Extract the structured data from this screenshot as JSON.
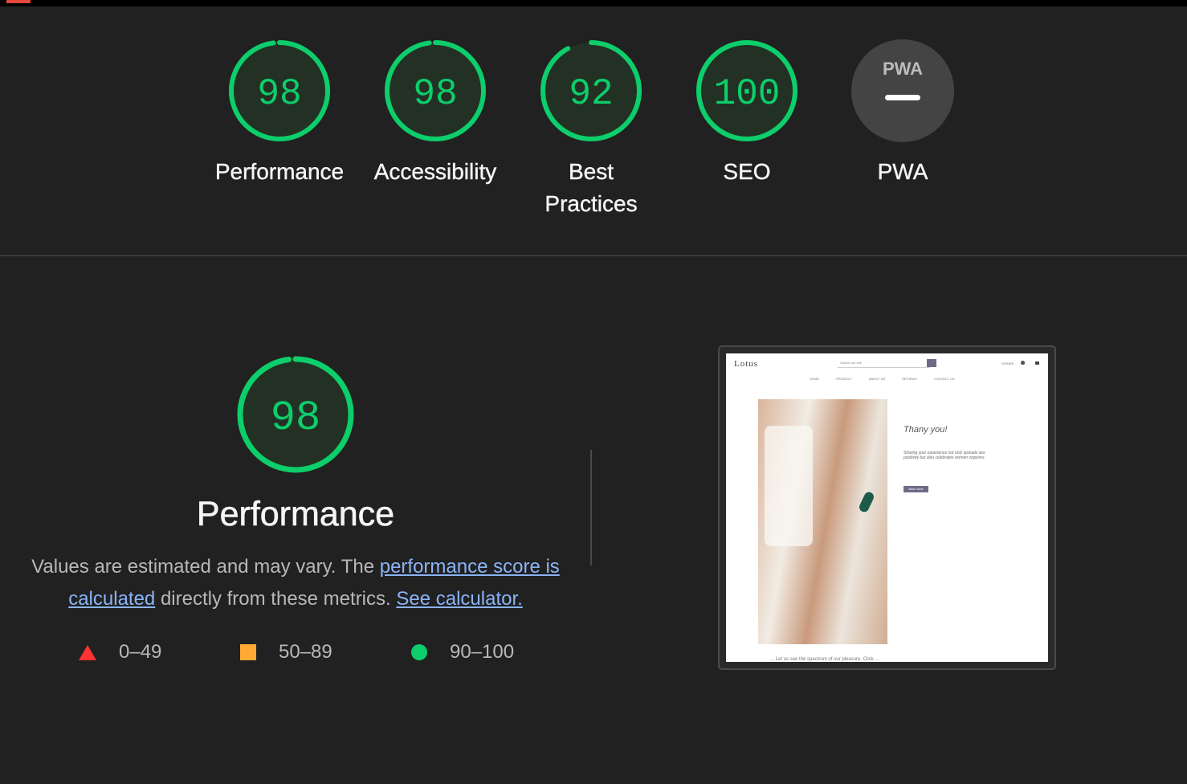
{
  "summary": {
    "gauges": [
      {
        "score": "98",
        "label_lines": [
          "Performance"
        ]
      },
      {
        "score": "98",
        "label_lines": [
          "Accessibility"
        ]
      },
      {
        "score": "92",
        "label_lines": [
          "Best",
          "Practices"
        ]
      },
      {
        "score": "100",
        "label_lines": [
          "SEO"
        ]
      }
    ],
    "pwa": {
      "badge": "PWA",
      "label": "PWA"
    }
  },
  "performance": {
    "score": "98",
    "title": "Performance",
    "desc_prefix": "Values are estimated and may vary. The ",
    "link_score": "performance score is calculated",
    "desc_middle": " directly from these metrics. ",
    "link_calculator": "See calculator.",
    "legend": [
      {
        "range": "0–49",
        "shape": "triangle",
        "color": "#ff3333"
      },
      {
        "range": "50–89",
        "shape": "square",
        "color": "#ffaa33"
      },
      {
        "range": "90–100",
        "shape": "circle",
        "color": "#0cce6b"
      }
    ]
  },
  "screenshot": {
    "logo": "Lotus",
    "search_placeholder": "Search our site",
    "owner": "OWNER",
    "nav": [
      "HOME",
      "PRODUCT",
      "ABOUT US",
      "REVIEWS",
      "CONTACT US"
    ],
    "heading": "Thany you!",
    "subtext": "Sharing your experience not only spreads sex positivity but also celebrates women orgasms",
    "button": "Back Home",
    "bottom_text": "... Let us see the spectrum of our pleasure. Click ..."
  },
  "colors": {
    "pass": "#0cce6b",
    "pass_fill": "#233124",
    "background": "#212121",
    "pwa_gray": "#444444",
    "link": "#8ab4f8"
  }
}
